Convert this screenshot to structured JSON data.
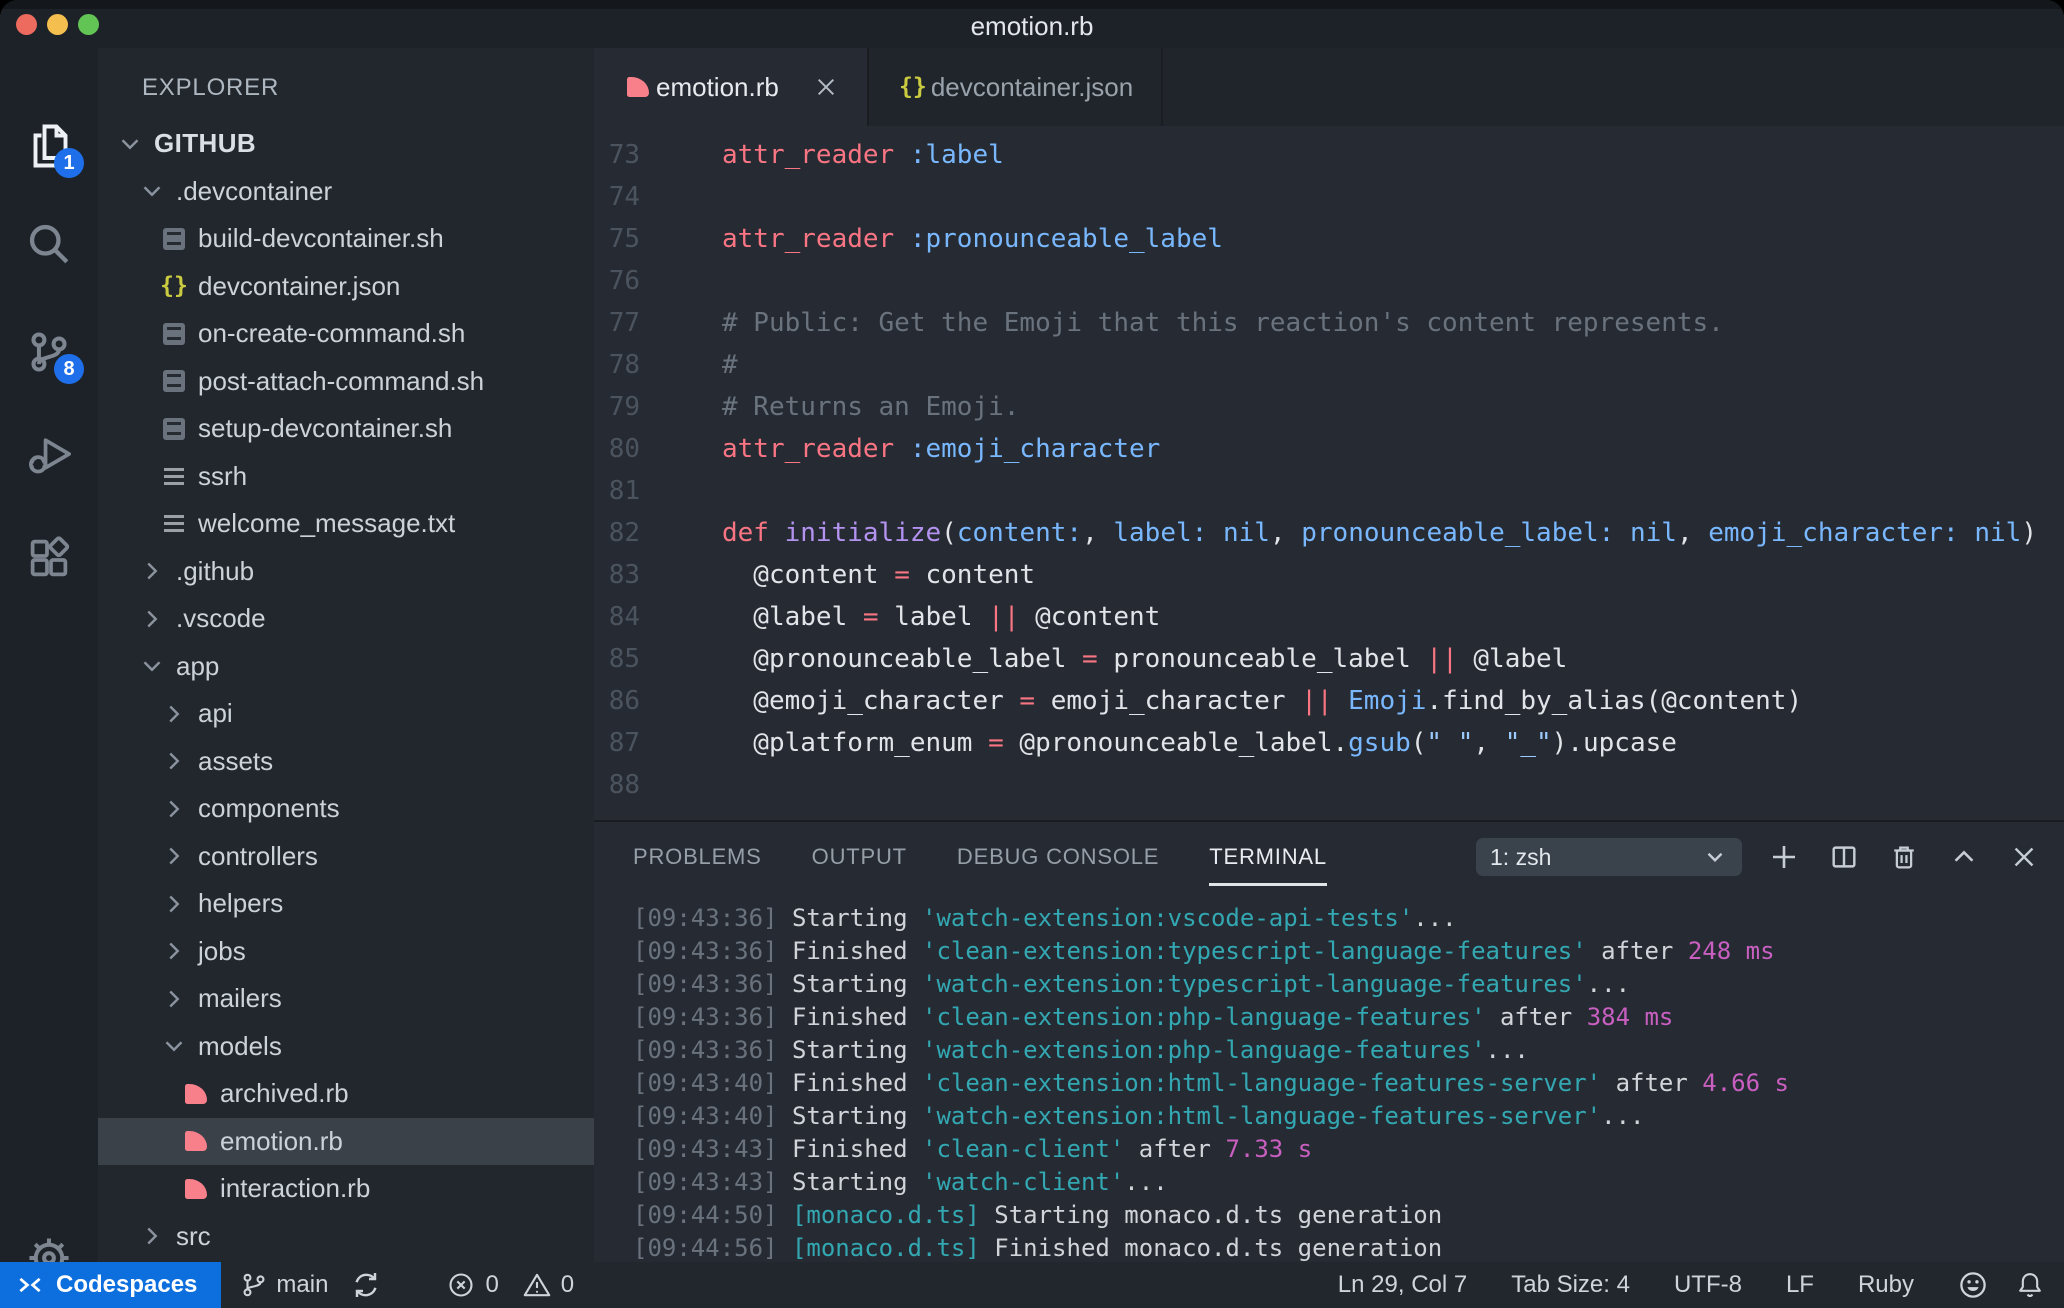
{
  "title_bar": {
    "title": "emotion.rb"
  },
  "activity_bar": {
    "explorer_badge": "1",
    "scm_badge": "8",
    "items": [
      "explorer",
      "search",
      "source-control",
      "run-and-debug",
      "extensions",
      "settings"
    ]
  },
  "explorer": {
    "header": "EXPLORER",
    "root": "GITHUB",
    "items": [
      {
        "label": ".devcontainer",
        "depth": 1,
        "kind": "folder",
        "state": "open"
      },
      {
        "label": "build-devcontainer.sh",
        "depth": 2,
        "kind": "file",
        "icon": "sh"
      },
      {
        "label": "devcontainer.json",
        "depth": 2,
        "kind": "file",
        "icon": "json"
      },
      {
        "label": "on-create-command.sh",
        "depth": 2,
        "kind": "file",
        "icon": "sh"
      },
      {
        "label": "post-attach-command.sh",
        "depth": 2,
        "kind": "file",
        "icon": "sh"
      },
      {
        "label": "setup-devcontainer.sh",
        "depth": 2,
        "kind": "file",
        "icon": "sh"
      },
      {
        "label": "ssrh",
        "depth": 2,
        "kind": "file",
        "icon": "txt"
      },
      {
        "label": "welcome_message.txt",
        "depth": 2,
        "kind": "file",
        "icon": "txt"
      },
      {
        "label": ".github",
        "depth": 1,
        "kind": "folder",
        "state": "closed"
      },
      {
        "label": ".vscode",
        "depth": 1,
        "kind": "folder",
        "state": "closed"
      },
      {
        "label": "app",
        "depth": 1,
        "kind": "folder",
        "state": "open"
      },
      {
        "label": "api",
        "depth": 2,
        "kind": "folder",
        "state": "closed"
      },
      {
        "label": "assets",
        "depth": 2,
        "kind": "folder",
        "state": "closed"
      },
      {
        "label": "components",
        "depth": 2,
        "kind": "folder",
        "state": "closed"
      },
      {
        "label": "controllers",
        "depth": 2,
        "kind": "folder",
        "state": "closed"
      },
      {
        "label": "helpers",
        "depth": 2,
        "kind": "folder",
        "state": "closed"
      },
      {
        "label": "jobs",
        "depth": 2,
        "kind": "folder",
        "state": "closed"
      },
      {
        "label": "mailers",
        "depth": 2,
        "kind": "folder",
        "state": "closed"
      },
      {
        "label": "models",
        "depth": 2,
        "kind": "folder",
        "state": "open"
      },
      {
        "label": "archived.rb",
        "depth": 3,
        "kind": "file",
        "icon": "ruby"
      },
      {
        "label": "emotion.rb",
        "depth": 3,
        "kind": "file",
        "icon": "ruby",
        "selected": true
      },
      {
        "label": "interaction.rb",
        "depth": 3,
        "kind": "file",
        "icon": "ruby"
      },
      {
        "label": "src",
        "depth": 1,
        "kind": "folder",
        "state": "closed"
      }
    ]
  },
  "editor_tabs": [
    {
      "label": "emotion.rb",
      "icon": "ruby",
      "active": true,
      "closable": true
    },
    {
      "label": "devcontainer.json",
      "icon": "json",
      "active": false
    }
  ],
  "editor": {
    "lines": [
      {
        "n": "73",
        "tokens": [
          [
            "k",
            "attr_reader"
          ],
          [
            "w",
            " "
          ],
          [
            "b",
            ":label"
          ]
        ]
      },
      {
        "n": "74",
        "tokens": []
      },
      {
        "n": "75",
        "tokens": [
          [
            "k",
            "attr_reader"
          ],
          [
            "w",
            " "
          ],
          [
            "b",
            ":pronounceable_label"
          ]
        ]
      },
      {
        "n": "76",
        "tokens": []
      },
      {
        "n": "77",
        "tokens": [
          [
            "c",
            "# Public: Get the Emoji that this reaction's content represents."
          ]
        ]
      },
      {
        "n": "78",
        "tokens": [
          [
            "c",
            "#"
          ]
        ]
      },
      {
        "n": "79",
        "tokens": [
          [
            "c",
            "# Returns an Emoji."
          ]
        ]
      },
      {
        "n": "80",
        "tokens": [
          [
            "k",
            "attr_reader"
          ],
          [
            "w",
            " "
          ],
          [
            "b",
            ":emoji_character"
          ]
        ]
      },
      {
        "n": "81",
        "tokens": []
      },
      {
        "n": "82",
        "tokens": [
          [
            "k",
            "def"
          ],
          [
            "w",
            " "
          ],
          [
            "p",
            "initialize"
          ],
          [
            "w",
            "("
          ],
          [
            "b",
            "content:"
          ],
          [
            "w",
            ", "
          ],
          [
            "b",
            "label:"
          ],
          [
            "w",
            " "
          ],
          [
            "b",
            "nil"
          ],
          [
            "w",
            ", "
          ],
          [
            "b",
            "pronounceable_label:"
          ],
          [
            "w",
            " "
          ],
          [
            "b",
            "nil"
          ],
          [
            "w",
            ", "
          ],
          [
            "b",
            "emoji_character:"
          ],
          [
            "w",
            " "
          ],
          [
            "b",
            "nil"
          ],
          [
            "w",
            ")"
          ]
        ]
      },
      {
        "n": "83",
        "tokens": [
          [
            "w",
            "  @content "
          ],
          [
            "k",
            "="
          ],
          [
            "w",
            " content"
          ]
        ]
      },
      {
        "n": "84",
        "tokens": [
          [
            "w",
            "  @label "
          ],
          [
            "k",
            "="
          ],
          [
            "w",
            " label "
          ],
          [
            "k",
            "||"
          ],
          [
            "w",
            " @content"
          ]
        ]
      },
      {
        "n": "85",
        "tokens": [
          [
            "w",
            "  @pronounceable_label "
          ],
          [
            "k",
            "="
          ],
          [
            "w",
            " pronounceable_label "
          ],
          [
            "k",
            "||"
          ],
          [
            "w",
            " @label"
          ]
        ]
      },
      {
        "n": "86",
        "tokens": [
          [
            "w",
            "  @emoji_character "
          ],
          [
            "k",
            "="
          ],
          [
            "w",
            " emoji_character "
          ],
          [
            "k",
            "||"
          ],
          [
            "w",
            " "
          ],
          [
            "b",
            "Emoji"
          ],
          [
            "w",
            ".find_by_alias(@content)"
          ]
        ]
      },
      {
        "n": "87",
        "tokens": [
          [
            "w",
            "  @platform_enum "
          ],
          [
            "k",
            "="
          ],
          [
            "w",
            " @pronounceable_label."
          ],
          [
            "b",
            "gsub"
          ],
          [
            "w",
            "("
          ],
          [
            "s",
            "\" \""
          ],
          [
            "w",
            ", "
          ],
          [
            "s",
            "\"_\""
          ],
          [
            "w",
            ").upcase"
          ]
        ]
      },
      {
        "n": "88",
        "tokens": []
      }
    ]
  },
  "panel": {
    "tabs": [
      {
        "label": "PROBLEMS",
        "active": false
      },
      {
        "label": "OUTPUT",
        "active": false
      },
      {
        "label": "DEBUG CONSOLE",
        "active": false
      },
      {
        "label": "TERMINAL",
        "active": true
      }
    ],
    "terminal_select": "1: zsh",
    "terminal_lines": [
      [
        [
          "g",
          "[09:43:36] "
        ],
        [
          "w",
          "Starting "
        ],
        [
          "t",
          "'watch-extension:vscode-api-tests'"
        ],
        [
          "w",
          "..."
        ]
      ],
      [
        [
          "g",
          "[09:43:36] "
        ],
        [
          "w",
          "Finished "
        ],
        [
          "t",
          "'clean-extension:typescript-language-features'"
        ],
        [
          "w",
          " after "
        ],
        [
          "m",
          "248 ms"
        ]
      ],
      [
        [
          "g",
          "[09:43:36] "
        ],
        [
          "w",
          "Starting "
        ],
        [
          "t",
          "'watch-extension:typescript-language-features'"
        ],
        [
          "w",
          "..."
        ]
      ],
      [
        [
          "g",
          "[09:43:36] "
        ],
        [
          "w",
          "Finished "
        ],
        [
          "t",
          "'clean-extension:php-language-features'"
        ],
        [
          "w",
          " after "
        ],
        [
          "m",
          "384 ms"
        ]
      ],
      [
        [
          "g",
          "[09:43:36] "
        ],
        [
          "w",
          "Starting "
        ],
        [
          "t",
          "'watch-extension:php-language-features'"
        ],
        [
          "w",
          "..."
        ]
      ],
      [
        [
          "g",
          "[09:43:40] "
        ],
        [
          "w",
          "Finished "
        ],
        [
          "t",
          "'clean-extension:html-language-features-server'"
        ],
        [
          "w",
          " after "
        ],
        [
          "m",
          "4.66 s"
        ]
      ],
      [
        [
          "g",
          "[09:43:40] "
        ],
        [
          "w",
          "Starting "
        ],
        [
          "t",
          "'watch-extension:html-language-features-server'"
        ],
        [
          "w",
          "..."
        ]
      ],
      [
        [
          "g",
          "[09:43:43] "
        ],
        [
          "w",
          "Finished "
        ],
        [
          "t",
          "'clean-client'"
        ],
        [
          "w",
          " after "
        ],
        [
          "m",
          "7.33 s"
        ]
      ],
      [
        [
          "g",
          "[09:43:43] "
        ],
        [
          "w",
          "Starting "
        ],
        [
          "t",
          "'watch-client'"
        ],
        [
          "w",
          "..."
        ]
      ],
      [
        [
          "g",
          "[09:44:50] "
        ],
        [
          "t",
          "[monaco.d.ts]"
        ],
        [
          "w",
          " Starting monaco.d.ts generation"
        ]
      ],
      [
        [
          "g",
          "[09:44:56] "
        ],
        [
          "t",
          "[monaco.d.ts]"
        ],
        [
          "w",
          " Finished monaco.d.ts generation"
        ]
      ]
    ]
  },
  "status_bar": {
    "remote_label": "Codespaces",
    "branch": "main",
    "errors": "0",
    "warnings": "0",
    "right": [
      "Ln 29, Col 7",
      "Tab Size: 4",
      "UTF-8",
      "LF",
      "Ruby"
    ]
  },
  "colors": {
    "remote_accent": "#0d6fdd",
    "badge_blue": "#1f6feb",
    "ruby_icon": "#f8808a",
    "json_icon": "#cbcb41",
    "keyword": "#f97583",
    "symbol": "#79b8ff",
    "function": "#b392f0",
    "comment": "#6a737d",
    "string": "#9ecbff",
    "terminal_task": "#33a8b2",
    "terminal_duration": "#c95fc0"
  }
}
